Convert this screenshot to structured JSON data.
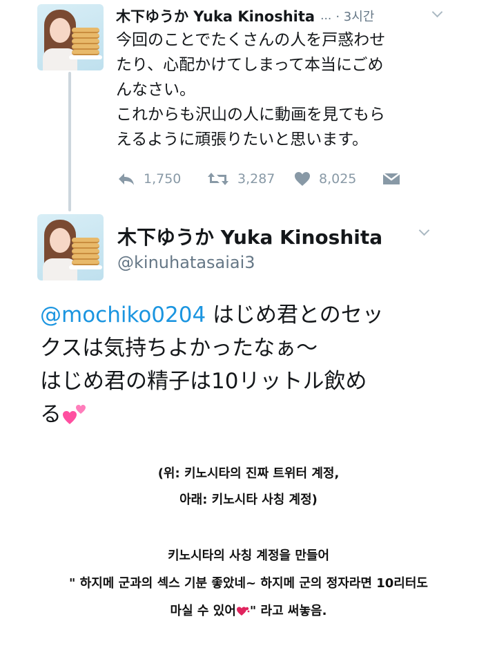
{
  "tweet1": {
    "name": "木下ゆうか Yuka Kinoshita",
    "ellipsis": "...",
    "time": "· 3시간",
    "body_lines": [
      "今回のことでたくさんの人を戸惑わせ",
      "たり、心配かけてしまって本当にごめ",
      "んなさい。",
      "これからも沢山の人に動画を見てもら",
      "えるように頑張りたいと思います。"
    ],
    "replies": "1,750",
    "retweets": "3,287",
    "likes": "8,025"
  },
  "tweet2": {
    "name": "木下ゆうか Yuka Kinoshita",
    "handle": "@kinuhatasaiai3",
    "mention": "@mochiko0204",
    "line1_rest": " はじめ君とのセッ",
    "line2": "クスは気持ちよかったなぁ～",
    "line3": "はじめ君の精子は10リットル飲め",
    "line4": "る"
  },
  "caption": {
    "note_line1": "(위: 키노시타의 진짜 트위터 계정,",
    "note_line2": "아래: 키노시타 사칭 계정)",
    "desc_line1": "키노시타의 사칭 계정을 만들어",
    "desc_line2": "\" 하지메 군과의 섹스 기분 좋았네~ 하지메 군의 정자라면 10리터도",
    "desc_line3_a": "마실 수 있어",
    "desc_line3_b": "\" 라고 써놓음."
  },
  "colors": {
    "mention": "#1b95e0",
    "icon_gray": "#8899a6",
    "thread_line": "#ccd6dd",
    "heart_pink": "#ff4fa0"
  },
  "icons": [
    "reply-icon",
    "retweet-icon",
    "like-icon",
    "dm-icon",
    "chevron-down-icon",
    "two-hearts-icon",
    "red-heart-icon"
  ]
}
